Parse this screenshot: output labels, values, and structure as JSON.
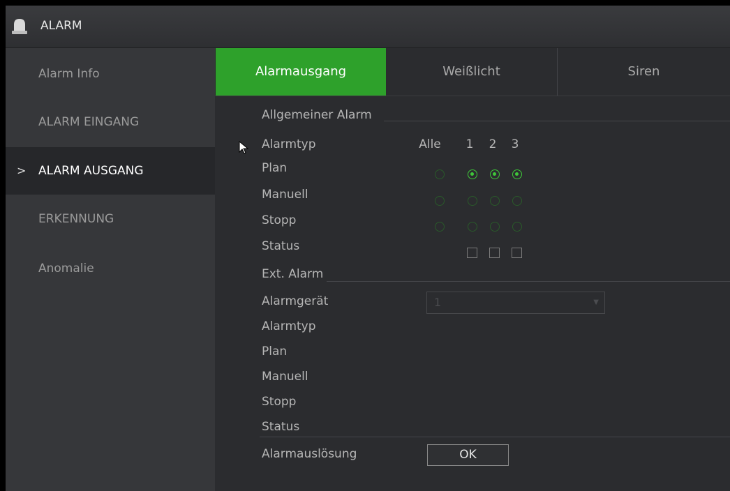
{
  "window": {
    "title": "ALARM",
    "icon": "alarm-bell-icon"
  },
  "sidebar": {
    "items": [
      {
        "label": "Alarm Info",
        "active": false
      },
      {
        "label": "ALARM EINGANG",
        "active": false
      },
      {
        "label": "ALARM AUSGANG",
        "active": true,
        "marker": ">"
      },
      {
        "label": "ERKENNUNG",
        "active": false
      },
      {
        "label": "Anomalie",
        "active": false
      }
    ]
  },
  "tabs": [
    {
      "label": "Alarmausgang",
      "active": true
    },
    {
      "label": "Weißlicht",
      "active": false
    },
    {
      "label": "Siren",
      "active": false
    }
  ],
  "general": {
    "section_title": "Allgemeiner Alarm",
    "alarm_type_label": "Alarmtyp",
    "columns": [
      "Alle",
      "1",
      "2",
      "3"
    ],
    "rows": [
      {
        "label": "Plan",
        "selected": [
          false,
          true,
          true,
          true
        ]
      },
      {
        "label": "Manuell",
        "selected": [
          false,
          false,
          false,
          false
        ]
      },
      {
        "label": "Stopp",
        "selected": [
          false,
          false,
          false,
          false
        ]
      }
    ],
    "status_label": "Status",
    "status": [
      false,
      false,
      false
    ]
  },
  "external": {
    "section_title": "Ext. Alarm",
    "device_label": "Alarmgerät",
    "device_value": "1",
    "rows": [
      "Alarmtyp",
      "Plan",
      "Manuell",
      "Stopp",
      "Status"
    ]
  },
  "trigger": {
    "label": "Alarmauslösung",
    "button": "OK"
  },
  "colors": {
    "accent": "#2ea12b",
    "radio_on": "#3fc83a",
    "radio_off": "#2a5a2a"
  }
}
